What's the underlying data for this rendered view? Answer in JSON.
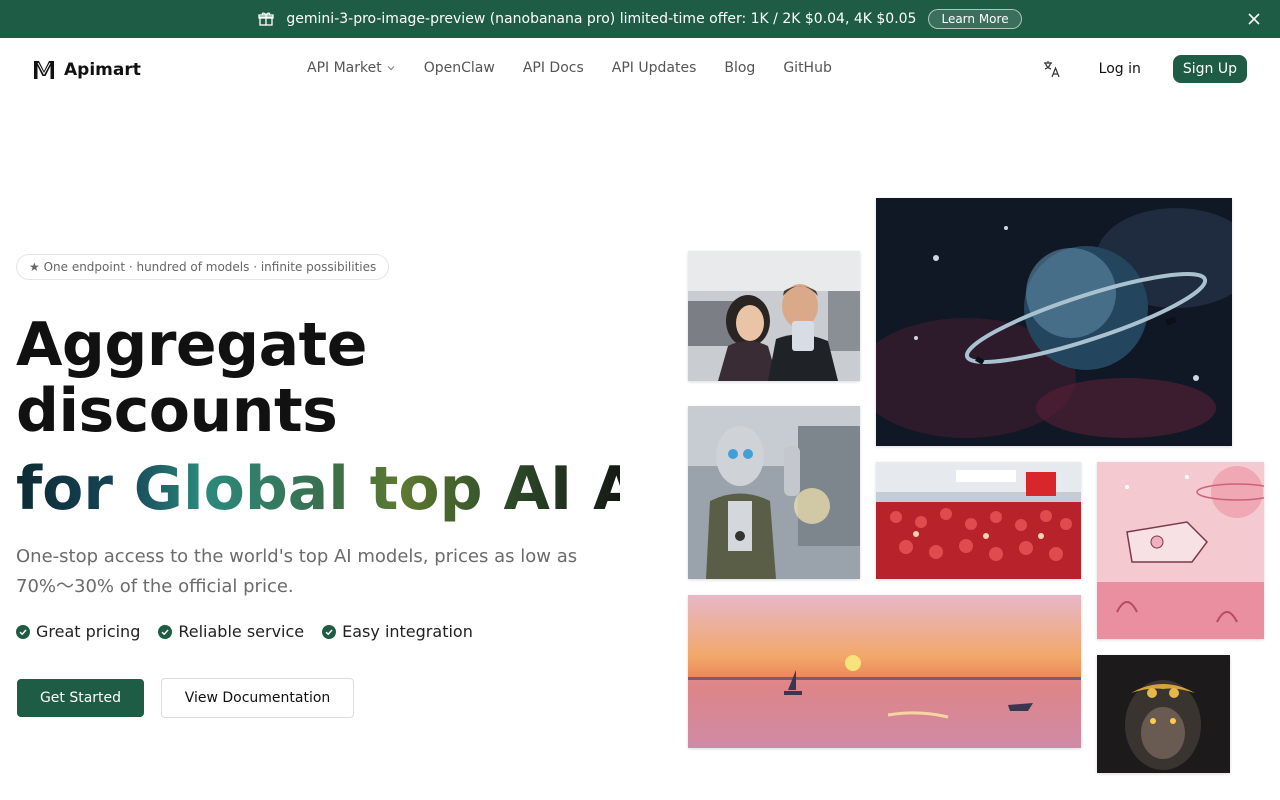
{
  "promo": {
    "text": "gemini-3-pro-image-preview (nanobanana pro) limited-time offer: 1K / 2K $0.04, 4K $0.05",
    "learn_more": "Learn More"
  },
  "header": {
    "brand": "Apimart",
    "nav": [
      {
        "label": "API Market",
        "has_dropdown": true
      },
      {
        "label": "OpenClaw"
      },
      {
        "label": "API Docs"
      },
      {
        "label": "API Updates"
      },
      {
        "label": "Blog"
      },
      {
        "label": "GitHub"
      }
    ],
    "login": "Log in",
    "signup": "Sign Up"
  },
  "hero": {
    "badge": "★ One endpoint · hundred of models · infinite possibilities",
    "title_line1": "Aggregate",
    "title_line2": "discounts",
    "title_gradient": "for Global top AI A",
    "subtitle": "One-stop access to the world's top AI models, prices as low as 70%～30% of the official price.",
    "features": [
      "Great pricing",
      "Reliable service",
      "Easy integration"
    ],
    "cta_primary": "Get Started",
    "cta_secondary": "View Documentation"
  },
  "colors": {
    "brand": "#1e5c46",
    "text": "#111111",
    "muted": "#6b6b6b"
  },
  "gallery": [
    "selfie-photo",
    "planet-art",
    "robot-photo",
    "crowd-photo",
    "spaceship-art",
    "sunset-painting",
    "monkey-king-art"
  ]
}
